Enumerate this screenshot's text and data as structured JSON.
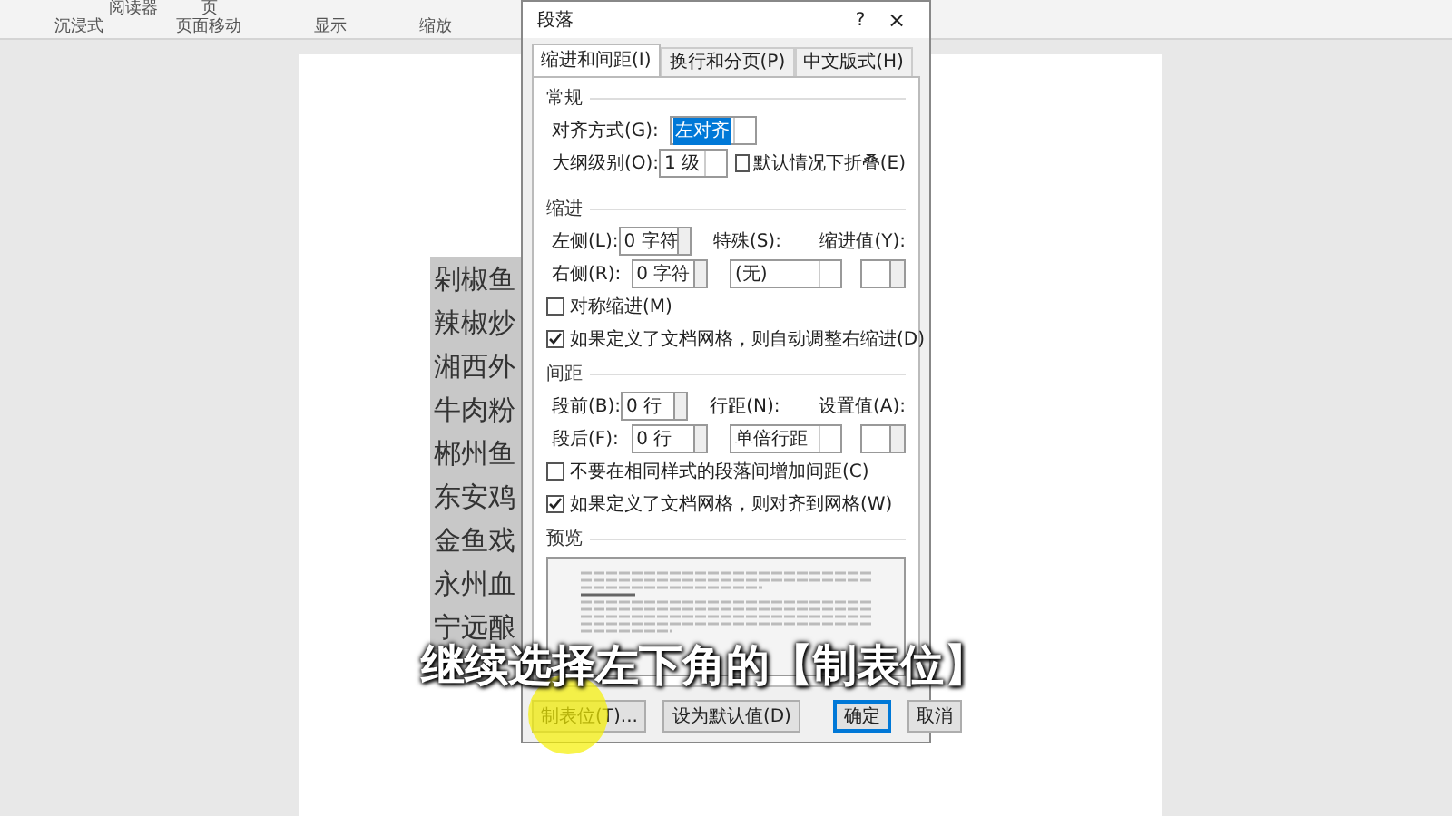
{
  "ribbon": {
    "top_items": [
      "阅读器",
      "页"
    ],
    "groups": [
      "沉浸式",
      "页面移动",
      "显示",
      "缩放"
    ]
  },
  "document": {
    "lines": [
      "剁椒鱼",
      "辣椒炒",
      "湘西外",
      "牛肉粉",
      "郴州鱼",
      "东安鸡",
      "金鱼戏",
      "永州血",
      "宁远酿"
    ]
  },
  "dialog": {
    "title": "段落",
    "help": "?",
    "close": "×",
    "tabs": [
      {
        "label": "缩进和间距(I)",
        "selected": true
      },
      {
        "label": "换行和分页(P)",
        "selected": false
      },
      {
        "label": "中文版式(H)",
        "selected": false
      }
    ],
    "general": {
      "heading": "常规",
      "alignment_label": "对齐方式(G):",
      "alignment": "左对齐",
      "outline_label": "大纲级别(O):",
      "outline": "1 级",
      "collapse": {
        "label": "默认情况下折叠(E)",
        "checked": false
      }
    },
    "indent": {
      "heading": "缩进",
      "left_label": "左侧(L):",
      "left": "0 字符",
      "right_label": "右侧(R):",
      "right": "0 字符",
      "special_label": "特殊(S):",
      "special": "(无)",
      "by_label": "缩进值(Y):",
      "checks": [
        {
          "label": "对称缩进(M)",
          "checked": false
        },
        {
          "label": "如果定义了文档网格，则自动调整右缩进(D)",
          "checked": true
        }
      ]
    },
    "spacing": {
      "heading": "间距",
      "before_label": "段前(B):",
      "before": "0 行",
      "after_label": "段后(F):",
      "after": "0 行",
      "line_label": "行距(N):",
      "line": "单倍行距",
      "at_label": "设置值(A):",
      "checks": [
        {
          "label": "不要在相同样式的段落间增加间距(C)",
          "checked": false
        },
        {
          "label": "如果定义了文档网格，则对齐到网格(W)",
          "checked": true
        }
      ]
    },
    "preview": {
      "heading": "预览"
    },
    "buttons": [
      {
        "label": "制表位(T)...",
        "default": false
      },
      {
        "label": "设为默认值(D)",
        "default": false
      },
      {
        "label": "确定",
        "default": true
      },
      {
        "label": "取消",
        "default": false
      }
    ]
  },
  "caption": "继续选择左下角的【制表位】"
}
